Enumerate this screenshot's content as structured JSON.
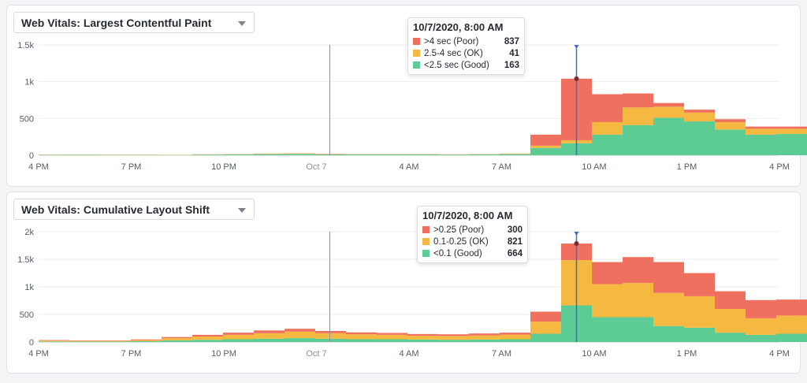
{
  "colors": {
    "poor": "#f0705f",
    "ok": "#f5b942",
    "good": "#5ccb94",
    "cursor": "#3f6bc4",
    "marker": "#8a9099"
  },
  "x_tick_labels": [
    "4 PM",
    "7 PM",
    "10 PM",
    "Oct 7",
    "4 AM",
    "7 AM",
    "10 AM",
    "1 PM",
    "4 PM"
  ],
  "panels": [
    {
      "selector_label": "Web Vitals: Largest Contentful Paint",
      "tooltip": {
        "title": "10/7/2020, 8:00 AM",
        "rows": [
          {
            "label": ">4 sec (Poor)",
            "value": "837",
            "color_key": "poor"
          },
          {
            "label": "2.5-4 sec (OK)",
            "value": "41",
            "color_key": "ok"
          },
          {
            "label": "<2.5 sec (Good)",
            "value": "163",
            "color_key": "good"
          }
        ]
      }
    },
    {
      "selector_label": "Web Vitals: Cumulative Layout Shift",
      "tooltip": {
        "title": "10/7/2020, 8:00 AM",
        "rows": [
          {
            "label": ">0.25 (Poor)",
            "value": "300",
            "color_key": "poor"
          },
          {
            "label": "0.1-0.25 (OK)",
            "value": "821",
            "color_key": "ok"
          },
          {
            "label": "<0.1 (Good)",
            "value": "664",
            "color_key": "good"
          }
        ]
      }
    }
  ],
  "chart_data": [
    {
      "type": "area",
      "title": "Web Vitals: Largest Contentful Paint",
      "x_unit": "hour",
      "x": [
        0,
        1,
        2,
        3,
        4,
        5,
        6,
        7,
        8,
        9,
        10,
        11,
        12,
        13,
        14,
        15,
        16,
        17,
        18,
        19,
        20,
        21,
        22,
        23
      ],
      "x_tick_labels": [
        "4 PM",
        "7 PM",
        "10 PM",
        "Oct 7",
        "4 AM",
        "7 AM",
        "10 AM",
        "1 PM",
        "4 PM"
      ],
      "y_ticks": [
        "0",
        "500",
        "1k",
        "1.5k"
      ],
      "ylim": [
        0,
        1500
      ],
      "series": [
        {
          "name": "<2.5 sec (Good)",
          "values": [
            5,
            5,
            4,
            4,
            3,
            8,
            10,
            15,
            18,
            12,
            10,
            10,
            10,
            8,
            10,
            15,
            100,
            163,
            280,
            410,
            510,
            460,
            350,
            280,
            290,
            220
          ]
        },
        {
          "name": "2.5-4 sec (OK)",
          "values": [
            2,
            2,
            2,
            2,
            2,
            3,
            4,
            5,
            6,
            5,
            4,
            4,
            4,
            3,
            4,
            5,
            30,
            41,
            170,
            240,
            150,
            120,
            100,
            80,
            70,
            60
          ]
        },
        {
          "name": ">4 sec (Poor)",
          "values": [
            1,
            1,
            1,
            1,
            1,
            2,
            2,
            3,
            3,
            3,
            2,
            2,
            2,
            2,
            2,
            3,
            150,
            837,
            380,
            190,
            50,
            40,
            40,
            30,
            30,
            30
          ]
        }
      ],
      "hover": {
        "x_index": 17,
        "label": "10/7/2020, 8:00 AM"
      },
      "marker_index": 9,
      "legend": "tooltip"
    },
    {
      "type": "area",
      "title": "Web Vitals: Cumulative Layout Shift",
      "x_unit": "hour",
      "x": [
        0,
        1,
        2,
        3,
        4,
        5,
        6,
        7,
        8,
        9,
        10,
        11,
        12,
        13,
        14,
        15,
        16,
        17,
        18,
        19,
        20,
        21,
        22,
        23
      ],
      "x_tick_labels": [
        "4 PM",
        "7 PM",
        "10 PM",
        "Oct 7",
        "4 AM",
        "7 AM",
        "10 AM",
        "1 PM",
        "4 PM"
      ],
      "y_ticks": [
        "0",
        "500",
        "1k",
        "1.5k",
        "2k"
      ],
      "ylim": [
        0,
        2000
      ],
      "series": [
        {
          "name": "<0.1 (Good)",
          "values": [
            10,
            8,
            8,
            15,
            30,
            40,
            50,
            60,
            70,
            60,
            50,
            50,
            45,
            40,
            45,
            50,
            150,
            664,
            450,
            450,
            290,
            260,
            170,
            130,
            150,
            130
          ]
        },
        {
          "name": "0.1-0.25 (OK)",
          "values": [
            15,
            12,
            12,
            20,
            40,
            60,
            80,
            100,
            120,
            100,
            90,
            80,
            70,
            70,
            75,
            85,
            220,
            821,
            600,
            620,
            600,
            570,
            430,
            300,
            330,
            270
          ]
        },
        {
          "name": ">0.25 (Poor)",
          "values": [
            10,
            8,
            8,
            12,
            20,
            30,
            40,
            50,
            50,
            40,
            35,
            35,
            30,
            30,
            35,
            35,
            180,
            300,
            400,
            470,
            560,
            420,
            320,
            330,
            290,
            210
          ]
        }
      ],
      "hover": {
        "x_index": 17,
        "label": "10/7/2020, 8:00 AM"
      },
      "marker_index": 9,
      "legend": "tooltip"
    }
  ]
}
